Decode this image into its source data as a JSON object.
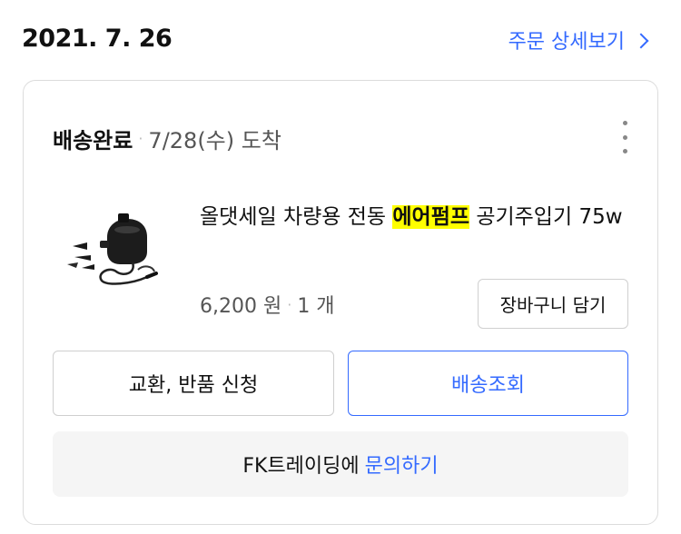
{
  "order": {
    "date": "2021. 7. 26",
    "detail_link": "주문 상세보기"
  },
  "delivery": {
    "status": "배송완료",
    "separator": "·",
    "arrival": "7/28(수) 도착"
  },
  "product": {
    "name_before": "올댓세일 차량용 전동 ",
    "name_highlight": "에어펌프",
    "name_after": " 공기주입기 75w",
    "price": "6,200 원",
    "separator": "·",
    "quantity": "1 개",
    "thumbnail_icon": "air-pump-product-image"
  },
  "actions": {
    "cart": "장바구니 담기",
    "return": "교환, 반품 신청",
    "track": "배송조회"
  },
  "inquiry": {
    "seller": "FK트레이딩에",
    "link": "문의하기"
  },
  "colors": {
    "accent": "#346aff",
    "highlight": "#ffff00"
  }
}
